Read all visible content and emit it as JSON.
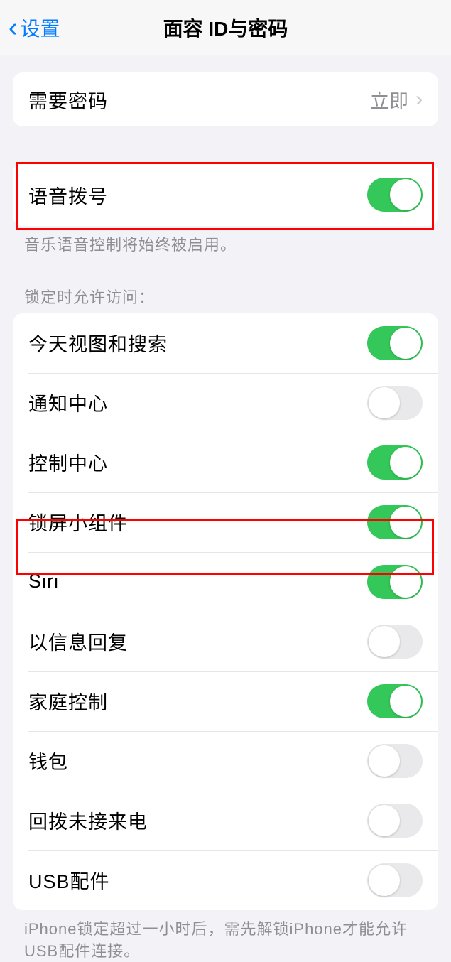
{
  "header": {
    "back_label": "设置",
    "title": "面容 ID与密码"
  },
  "passcode_group": {
    "require_passcode": {
      "label": "需要密码",
      "value": "立即"
    }
  },
  "voice_dial_group": {
    "voice_dial": {
      "label": "语音拨号",
      "on": true
    }
  },
  "voice_dial_footer": "音乐语音控制将始终被启用。",
  "lock_access_header": "锁定时允许访问：",
  "lock_access": [
    {
      "label": "今天视图和搜索",
      "on": true
    },
    {
      "label": "通知中心",
      "on": false
    },
    {
      "label": "控制中心",
      "on": true
    },
    {
      "label": "锁屏小组件",
      "on": true
    },
    {
      "label": "Siri",
      "on": true
    },
    {
      "label": "以信息回复",
      "on": false
    },
    {
      "label": "家庭控制",
      "on": true
    },
    {
      "label": "钱包",
      "on": false
    },
    {
      "label": "回拨未接来电",
      "on": false
    },
    {
      "label": "USB配件",
      "on": false
    }
  ],
  "usb_footer": "iPhone锁定超过一小时后，需先解锁iPhone才能允许USB配件连接。"
}
